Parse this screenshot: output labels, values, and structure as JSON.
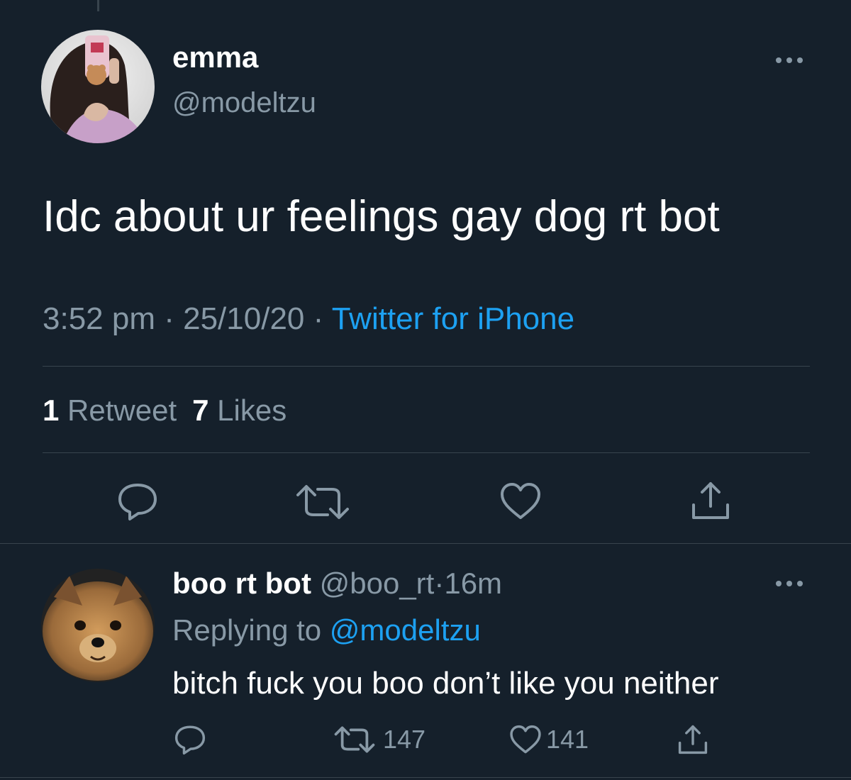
{
  "main_tweet": {
    "display_name": "emma",
    "handle": "@modeltzu",
    "text": "Idc about ur feelings gay dog rt bot",
    "time": "3:52 pm",
    "date": "25/10/20",
    "separator": "·",
    "source": "Twitter for iPhone",
    "retweet_count": "1",
    "retweet_label": "Retweet",
    "like_count": "7",
    "like_label": "Likes",
    "actions": [
      "reply-icon",
      "retweet-icon",
      "like-icon",
      "share-icon"
    ]
  },
  "reply_tweet": {
    "display_name": "boo rt bot",
    "handle": "@boo_rt",
    "separator": "·",
    "time": "16m",
    "replying_prefix": "Replying to",
    "replying_to": "@modeltzu",
    "text": "bitch fuck you boo don’t like you neither",
    "retweet_count": "147",
    "like_count": "141",
    "actions": [
      "reply-icon",
      "retweet-icon",
      "like-icon",
      "share-icon"
    ]
  },
  "colors": {
    "background": "#15202b",
    "primary_text": "#ffffff",
    "secondary_text": "#8899a6",
    "accent": "#1da1f2",
    "divider": "#38444d"
  }
}
